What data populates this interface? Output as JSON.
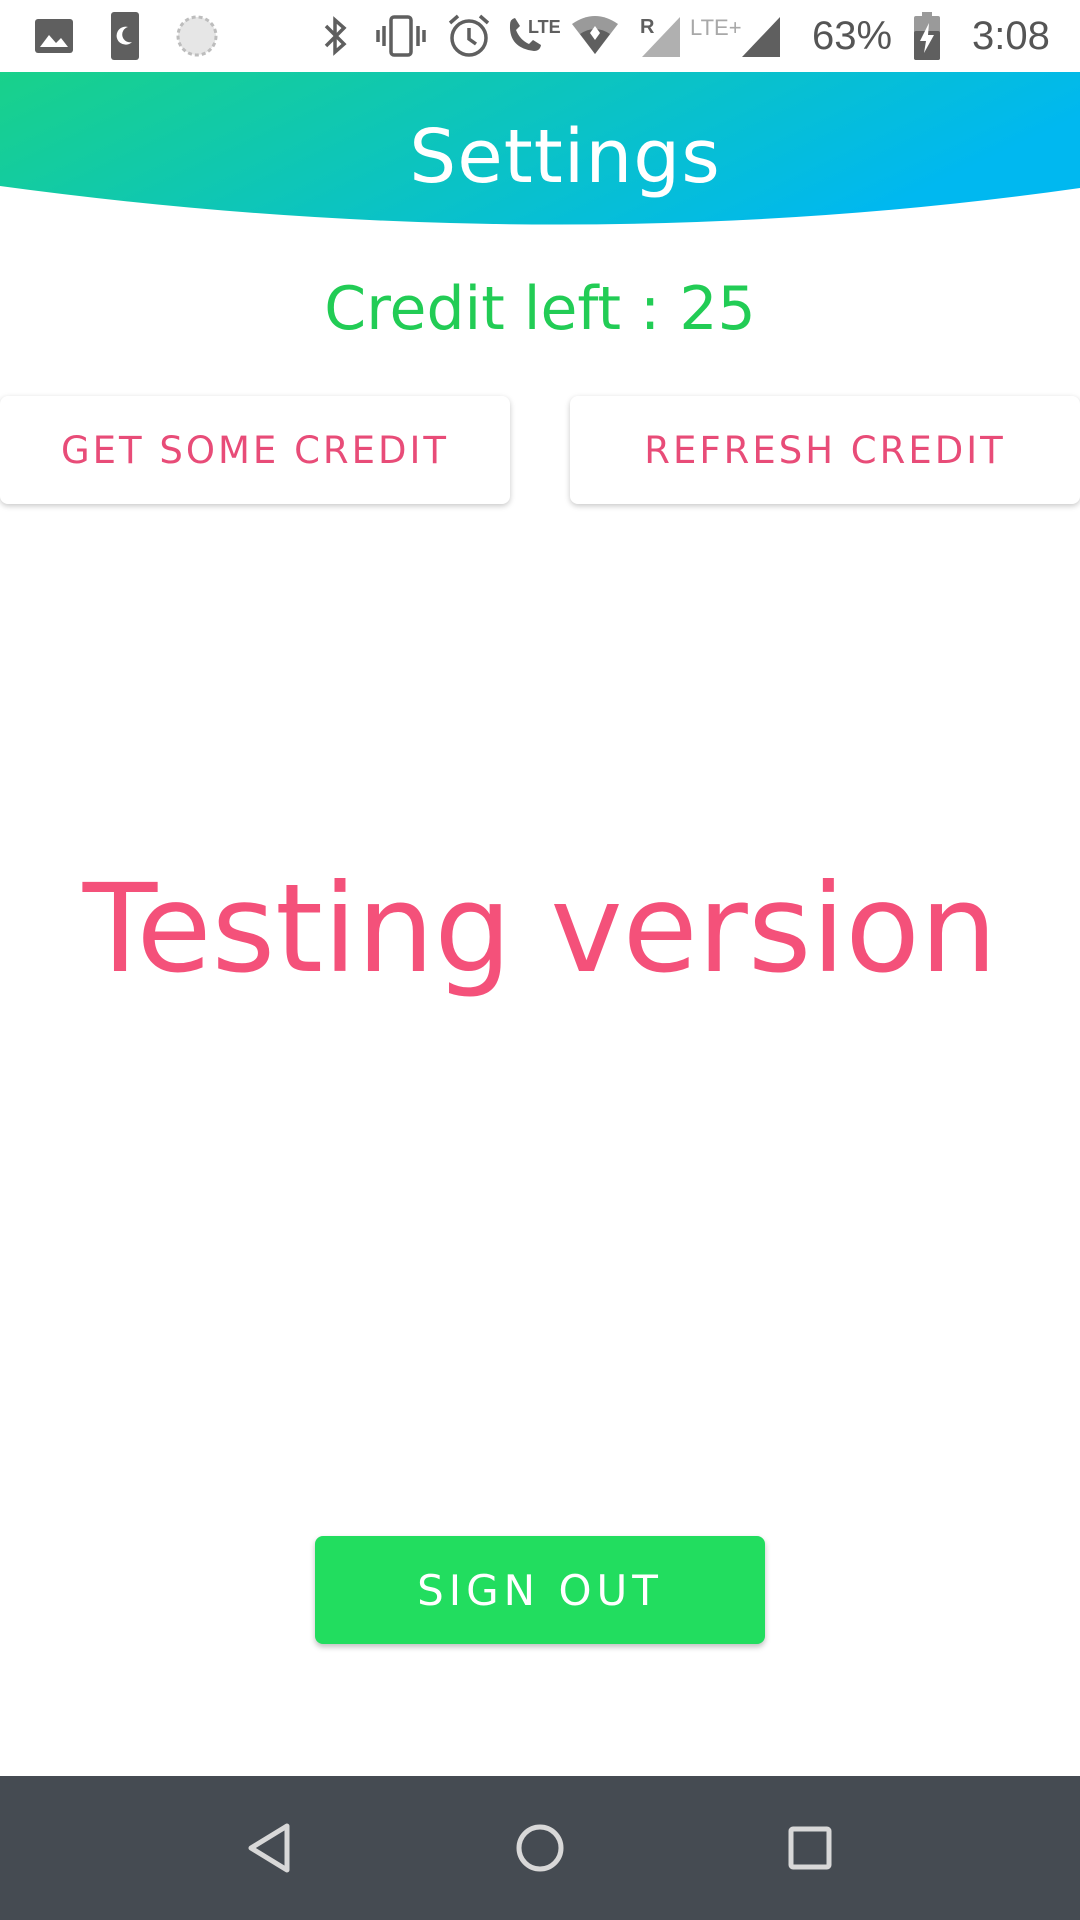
{
  "status_bar": {
    "battery": "63%",
    "time": "3:08",
    "lte_label": "LTE",
    "lte_plus_label": "LTE+",
    "roaming_label": "R",
    "icons": [
      "image-icon",
      "dnd-moon-icon",
      "sync-icon",
      "bluetooth-icon",
      "vibrate-icon",
      "alarm-icon",
      "volte-call-icon",
      "wifi-icon",
      "signal-roaming-icon",
      "signal-lte-icon",
      "battery-charging-icon"
    ]
  },
  "header": {
    "title": "Settings",
    "gradient_start": "#19d18a",
    "gradient_end": "#00b8f0"
  },
  "credit": {
    "text": "Credit left : 25"
  },
  "buttons": {
    "get_credit": "GET SOME CREDIT",
    "refresh_credit": "REFRESH CREDIT"
  },
  "main": {
    "testing_label": "Testing version"
  },
  "sign_out": {
    "label": "SIGN OUT"
  },
  "nav_bar": {
    "icons": [
      "back-icon",
      "home-icon",
      "recents-icon"
    ]
  },
  "colors": {
    "accent_pink": "#f4517a",
    "accent_green": "#22dd5f",
    "nav_bar": "#454b52"
  }
}
